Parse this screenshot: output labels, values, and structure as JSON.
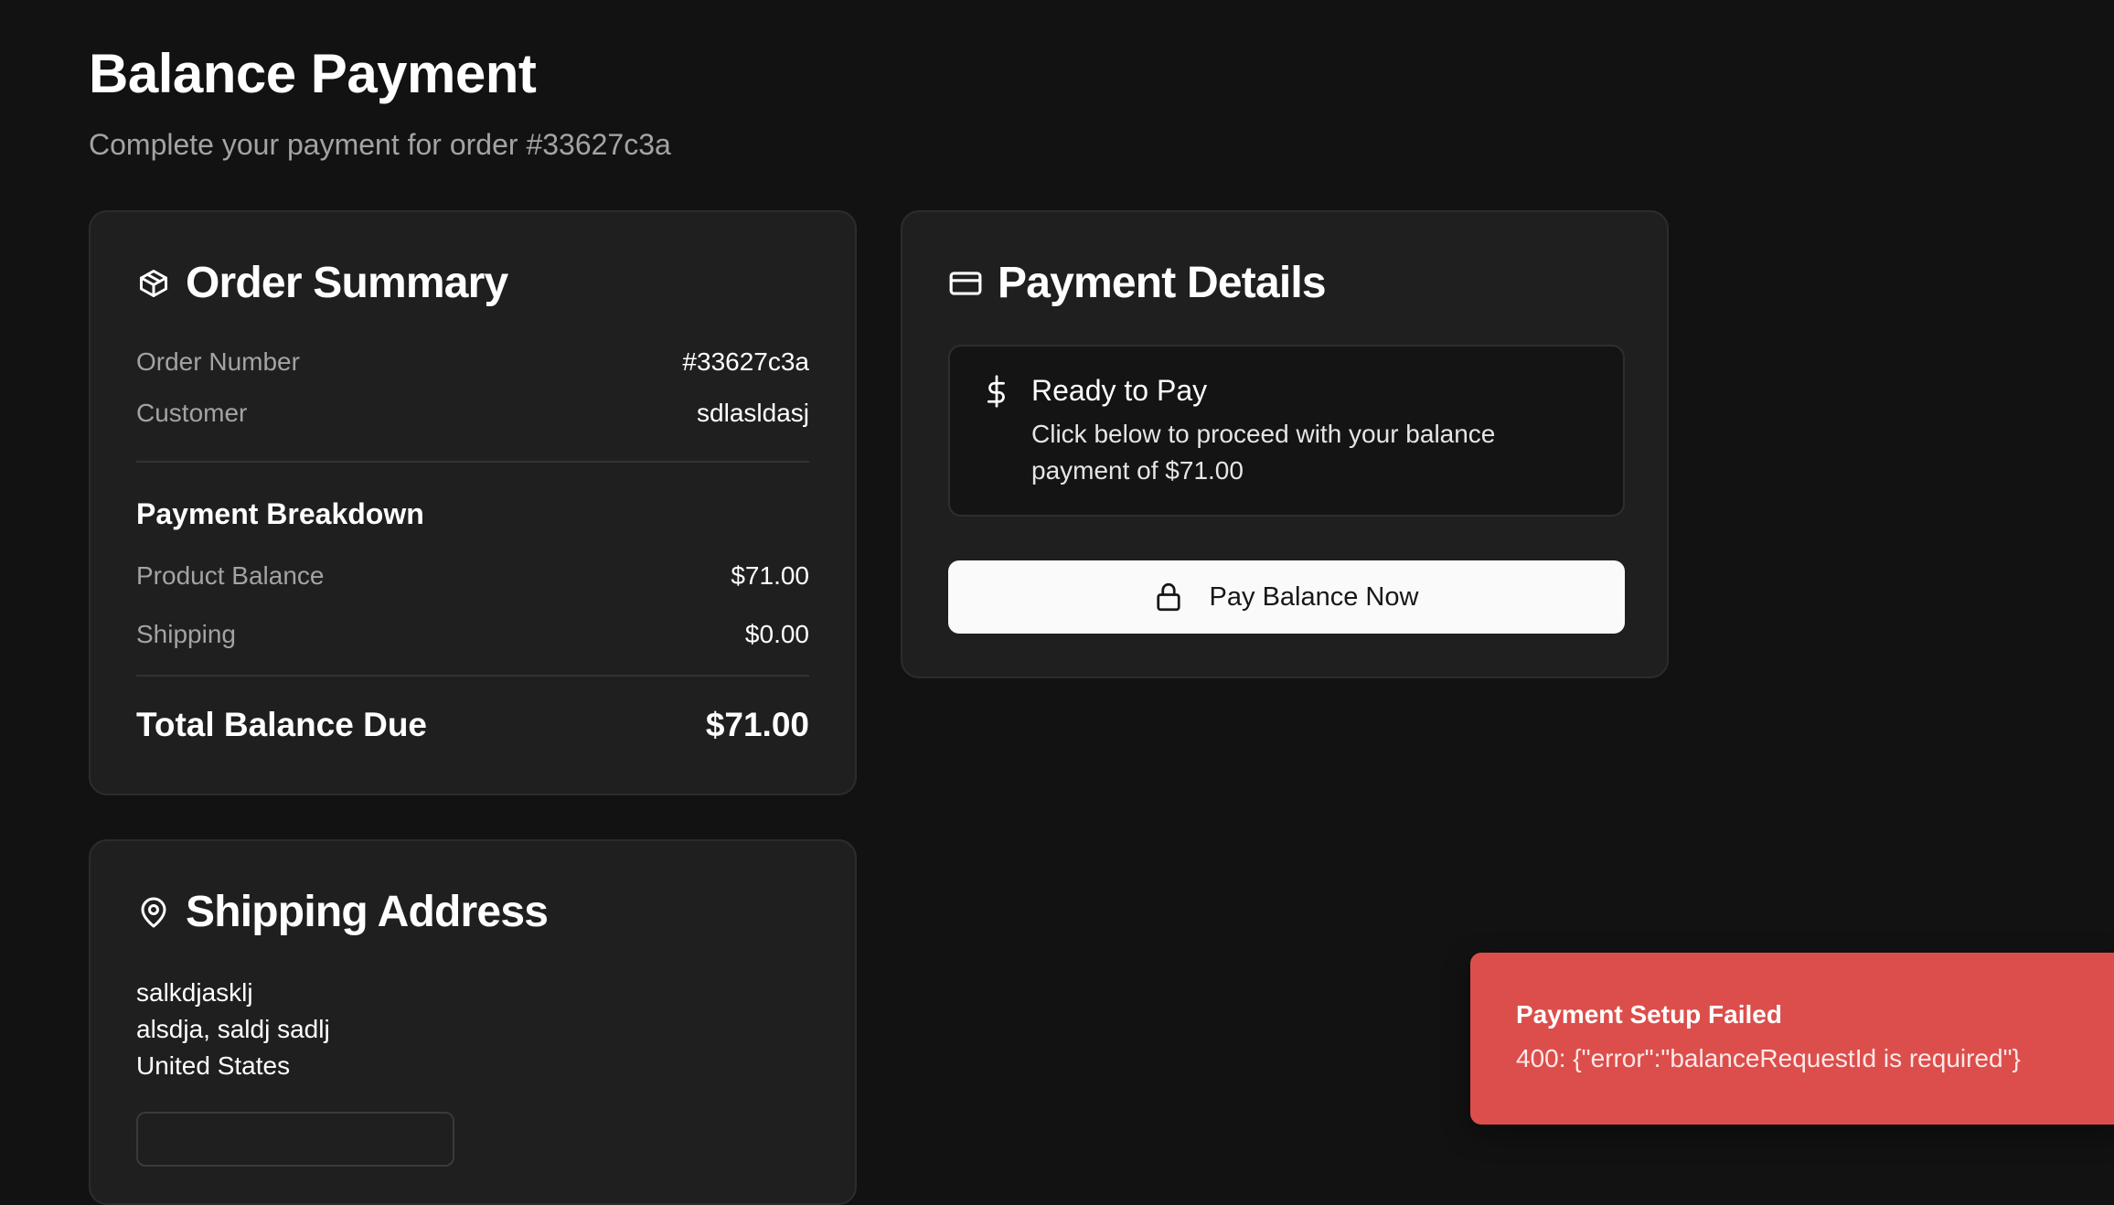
{
  "page": {
    "title": "Balance Payment",
    "subtitle": "Complete your payment for order #33627c3a"
  },
  "order_summary": {
    "title": "Order Summary",
    "icon": "package-icon",
    "order_number_label": "Order Number",
    "order_number_value": "#33627c3a",
    "customer_label": "Customer",
    "customer_value": "sdlasldasj",
    "breakdown_heading": "Payment Breakdown",
    "product_balance_label": "Product Balance",
    "product_balance_value": "$71.00",
    "shipping_label": "Shipping",
    "shipping_value": "$0.00",
    "total_label": "Total Balance Due",
    "total_value": "$71.00"
  },
  "payment_details": {
    "title": "Payment Details",
    "icon": "credit-card-icon",
    "ready_icon": "dollar-icon",
    "ready_title": "Ready to Pay",
    "ready_description": "Click below to proceed with your balance payment of $71.00",
    "pay_button_label": "Pay Balance Now",
    "pay_button_icon": "lock-icon"
  },
  "shipping_address": {
    "title": "Shipping Address",
    "icon": "map-pin-icon",
    "line1": "salkdjasklj",
    "line2": "alsdja, saldj sadlj",
    "line3": "United States"
  },
  "toast": {
    "title": "Payment Setup Failed",
    "message": "400: {\"error\":\"balanceRequestId is required\"}",
    "color": "#dc4e4b"
  }
}
